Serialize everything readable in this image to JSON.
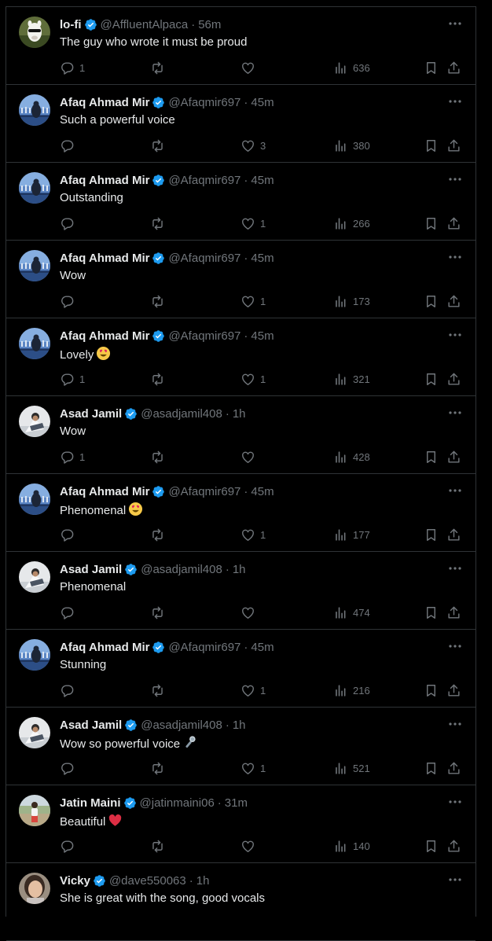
{
  "colors": {
    "background": "#000000",
    "text": "#e7e9ea",
    "muted": "#71767b",
    "verified": "#1d9bf0",
    "border": "#2f3336"
  },
  "tweets": [
    {
      "name": "lo-fi",
      "handle": "@AffluentAlpaca",
      "time": "56m",
      "text": "The guy who wrote it must be proud",
      "emoji": "",
      "replies": "1",
      "reposts": "",
      "likes": "",
      "views": "636",
      "avatar": "alpaca"
    },
    {
      "name": "Afaq Ahmad Mir",
      "handle": "@Afaqmir697",
      "time": "45m",
      "text": "Such a powerful voice",
      "emoji": "",
      "replies": "",
      "reposts": "",
      "likes": "3",
      "views": "380",
      "avatar": "sea"
    },
    {
      "name": "Afaq Ahmad Mir",
      "handle": "@Afaqmir697",
      "time": "45m",
      "text": "Outstanding",
      "emoji": "",
      "replies": "",
      "reposts": "",
      "likes": "1",
      "views": "266",
      "avatar": "sea"
    },
    {
      "name": "Afaq Ahmad Mir",
      "handle": "@Afaqmir697",
      "time": "45m",
      "text": "Wow",
      "emoji": "",
      "replies": "",
      "reposts": "",
      "likes": "1",
      "views": "173",
      "avatar": "sea"
    },
    {
      "name": "Afaq Ahmad Mir",
      "handle": "@Afaqmir697",
      "time": "45m",
      "text": "Lovely",
      "emoji": "heart-eyes",
      "replies": "1",
      "reposts": "",
      "likes": "1",
      "views": "321",
      "avatar": "sea"
    },
    {
      "name": "Asad Jamil",
      "handle": "@asadjamil408",
      "time": "1h",
      "text": "Wow",
      "emoji": "",
      "replies": "1",
      "reposts": "",
      "likes": "",
      "views": "428",
      "avatar": "person"
    },
    {
      "name": "Afaq Ahmad Mir",
      "handle": "@Afaqmir697",
      "time": "45m",
      "text": "Phenomenal",
      "emoji": "heart-eyes",
      "replies": "",
      "reposts": "",
      "likes": "1",
      "views": "177",
      "avatar": "sea"
    },
    {
      "name": "Asad Jamil",
      "handle": "@asadjamil408",
      "time": "1h",
      "text": "Phenomenal",
      "emoji": "",
      "replies": "",
      "reposts": "",
      "likes": "",
      "views": "474",
      "avatar": "person"
    },
    {
      "name": "Afaq Ahmad Mir",
      "handle": "@Afaqmir697",
      "time": "45m",
      "text": "Stunning",
      "emoji": "",
      "replies": "",
      "reposts": "",
      "likes": "1",
      "views": "216",
      "avatar": "sea"
    },
    {
      "name": "Asad Jamil",
      "handle": "@asadjamil408",
      "time": "1h",
      "text": "Wow so powerful voice",
      "emoji": "microphone",
      "replies": "",
      "reposts": "",
      "likes": "1",
      "views": "521",
      "avatar": "person"
    },
    {
      "name": "Jatin Maini",
      "handle": "@jatinmaini06",
      "time": "31m",
      "text": "Beautiful",
      "emoji": "red-heart",
      "replies": "",
      "reposts": "",
      "likes": "",
      "views": "140",
      "avatar": "outdoor"
    },
    {
      "name": "Vicky",
      "handle": "@dave550063",
      "time": "1h",
      "text": "She is great with the song, good vocals",
      "emoji": "",
      "replies": "",
      "reposts": "",
      "likes": "",
      "views": "",
      "avatar": "face"
    }
  ]
}
